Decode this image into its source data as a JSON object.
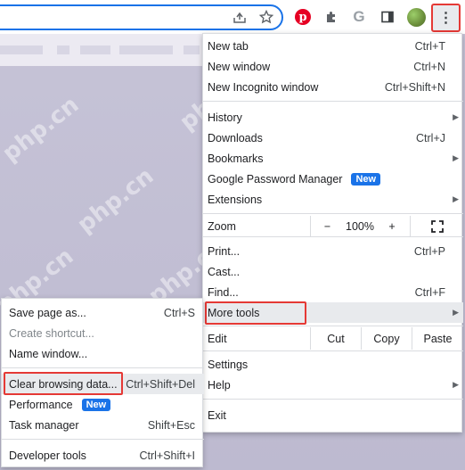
{
  "toolbar": {
    "icons": [
      "share-icon",
      "bookmark-star-icon",
      "pinterest-icon",
      "extensions-icon",
      "google-icon",
      "side-panel-icon",
      "profile-avatar-icon",
      "kebab-menu-icon"
    ],
    "google_glyph": "G",
    "menu_glyph": "⋮"
  },
  "watermark": "php.cn",
  "menu": {
    "new_tab": {
      "label": "New tab",
      "shortcut": "Ctrl+T"
    },
    "new_window": {
      "label": "New window",
      "shortcut": "Ctrl+N"
    },
    "new_incognito": {
      "label": "New Incognito window",
      "shortcut": "Ctrl+Shift+N"
    },
    "history": {
      "label": "History"
    },
    "downloads": {
      "label": "Downloads",
      "shortcut": "Ctrl+J"
    },
    "bookmarks": {
      "label": "Bookmarks"
    },
    "password_manager": {
      "label": "Google Password Manager",
      "badge": "New"
    },
    "extensions": {
      "label": "Extensions"
    },
    "zoom": {
      "label": "Zoom",
      "minus": "−",
      "level": "100%",
      "plus": "+"
    },
    "print": {
      "label": "Print...",
      "shortcut": "Ctrl+P"
    },
    "cast": {
      "label": "Cast..."
    },
    "find": {
      "label": "Find...",
      "shortcut": "Ctrl+F"
    },
    "more_tools": {
      "label": "More tools"
    },
    "edit": {
      "label": "Edit",
      "cut": "Cut",
      "copy": "Copy",
      "paste": "Paste"
    },
    "settings": {
      "label": "Settings"
    },
    "help": {
      "label": "Help"
    },
    "exit": {
      "label": "Exit"
    }
  },
  "submenu": {
    "save_page": {
      "label": "Save page as...",
      "shortcut": "Ctrl+S"
    },
    "create_shortcut": {
      "label": "Create shortcut..."
    },
    "name_window": {
      "label": "Name window..."
    },
    "clear_browsing": {
      "label": "Clear browsing data...",
      "shortcut": "Ctrl+Shift+Del"
    },
    "performance": {
      "label": "Performance",
      "badge": "New"
    },
    "task_manager": {
      "label": "Task manager",
      "shortcut": "Shift+Esc"
    },
    "developer_tools": {
      "label": "Developer tools",
      "shortcut": "Ctrl+Shift+I"
    }
  },
  "colors": {
    "accent": "#1a73e8",
    "highlight_box": "#e53935"
  }
}
